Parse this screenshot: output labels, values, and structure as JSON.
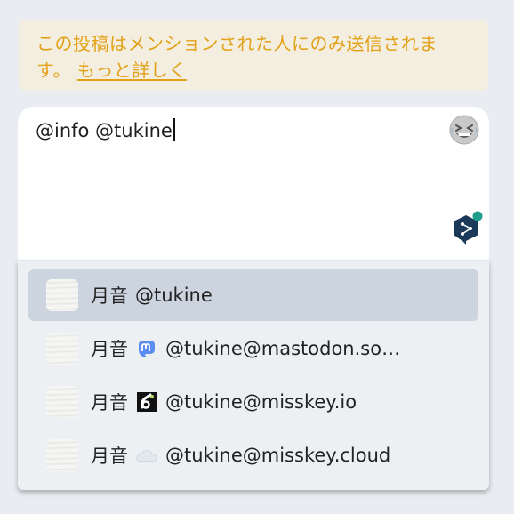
{
  "notice": {
    "text": "この投稿はメンションされた人にのみ送信されます。",
    "link": "もっと詳しく"
  },
  "editor": {
    "text": "@info @tukine",
    "emoji_icon": "grinning-squinting-emoji-icon",
    "translate_icon": "deepl-translate-icon"
  },
  "suggestions": [
    {
      "name": "月音",
      "account": "@tukine",
      "instance_icon": "",
      "selected": true
    },
    {
      "name": "月音",
      "account": "@tukine@mastodon.so…",
      "instance_icon": "mastodon-icon"
    },
    {
      "name": "月音",
      "account": "@tukine@misskey.io",
      "instance_icon": "misskey-icon"
    },
    {
      "name": "月音",
      "account": "@tukine@misskey.cloud",
      "instance_icon": "cloud-icon"
    }
  ],
  "colors": {
    "notice_text": "#e3a117",
    "notice_bg": "#f3eedf",
    "selected_row": "#ccd5df",
    "mastodon": "#5b8df1",
    "deepl": "#1b3a5a",
    "deepl_dot": "#1e9c8c"
  }
}
